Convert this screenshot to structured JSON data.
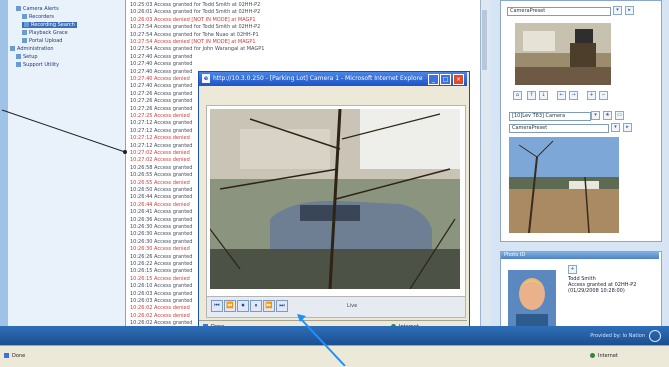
{
  "sidebar": {
    "items": [
      {
        "label": "Camera Alerts",
        "indent": 1
      },
      {
        "label": "Recorders",
        "indent": 2
      },
      {
        "label": "Recording Search",
        "indent": 2,
        "selected": true
      },
      {
        "label": "Playback Grace",
        "indent": 2
      },
      {
        "label": "Portal Upload",
        "indent": 2
      },
      {
        "label": "Administration",
        "indent": 0
      },
      {
        "label": "Setup",
        "indent": 1
      },
      {
        "label": "Support Utility",
        "indent": 1
      }
    ]
  },
  "log": {
    "lines": [
      {
        "time": "10:25:03",
        "text": "Access granted for Todd Smith at 02HH-P2",
        "status": "ok"
      },
      {
        "time": "10:26:01",
        "text": "Access granted for Todd Smith at 02HH-P2",
        "status": "ok"
      },
      {
        "time": "10:26:03",
        "text": "Access denied [NOT IN MODE] at MAGP1",
        "status": "bad"
      },
      {
        "time": "10:27:54",
        "text": "Access granted for Todd Smith at 02HH-P2",
        "status": "ok"
      },
      {
        "time": "10:27:54",
        "text": "Access granted for Tohe Nuao at 02HH-P1",
        "status": "ok"
      },
      {
        "time": "10:27:54",
        "text": "Access denied [NOT IN MODE] at MAGP1",
        "status": "bad"
      },
      {
        "time": "10:27:54",
        "text": "Access granted for John Warangal at MAGP1",
        "status": "ok"
      },
      {
        "time": "10:27:40",
        "text": "Access granted",
        "status": "ok"
      },
      {
        "time": "10:27:40",
        "text": "Access granted",
        "status": "ok"
      },
      {
        "time": "10:27:40",
        "text": "Access granted",
        "status": "ok"
      },
      {
        "time": "10:27:40",
        "text": "Access denied",
        "status": "bad"
      },
      {
        "time": "10:27:40",
        "text": "Access granted",
        "status": "ok"
      },
      {
        "time": "10:27:26",
        "text": "Access granted",
        "status": "ok"
      },
      {
        "time": "10:27:26",
        "text": "Access granted",
        "status": "ok"
      },
      {
        "time": "10:27:26",
        "text": "Access granted",
        "status": "ok"
      },
      {
        "time": "10:27:25",
        "text": "Access denied",
        "status": "bad"
      },
      {
        "time": "10:27:12",
        "text": "Access granted",
        "status": "ok"
      },
      {
        "time": "10:27:12",
        "text": "Access granted",
        "status": "ok"
      },
      {
        "time": "10:27:12",
        "text": "Access denied",
        "status": "bad"
      },
      {
        "time": "10:27:12",
        "text": "Access granted",
        "status": "ok"
      },
      {
        "time": "10:27:02",
        "text": "Access denied",
        "status": "bad"
      },
      {
        "time": "10:27:02",
        "text": "Access denied",
        "status": "bad"
      },
      {
        "time": "10:26:58",
        "text": "Access granted",
        "status": "ok"
      },
      {
        "time": "10:26:55",
        "text": "Access granted",
        "status": "ok"
      },
      {
        "time": "10:26:55",
        "text": "Access denied",
        "status": "bad"
      },
      {
        "time": "10:26:50",
        "text": "Access granted",
        "status": "ok"
      },
      {
        "time": "10:26:44",
        "text": "Access granted",
        "status": "ok"
      },
      {
        "time": "10:26:44",
        "text": "Access denied",
        "status": "bad"
      },
      {
        "time": "10:26:41",
        "text": "Access granted",
        "status": "ok"
      },
      {
        "time": "10:26:36",
        "text": "Access granted",
        "status": "ok"
      },
      {
        "time": "10:26:30",
        "text": "Access granted",
        "status": "ok"
      },
      {
        "time": "10:26:30",
        "text": "Access granted",
        "status": "ok"
      },
      {
        "time": "10:26:30",
        "text": "Access granted",
        "status": "ok"
      },
      {
        "time": "10:26:30",
        "text": "Access denied",
        "status": "bad"
      },
      {
        "time": "10:26:26",
        "text": "Access granted",
        "status": "ok"
      },
      {
        "time": "10:26:22",
        "text": "Access granted",
        "status": "ok"
      },
      {
        "time": "10:26:15",
        "text": "Access granted",
        "status": "ok"
      },
      {
        "time": "10:26:15",
        "text": "Access denied",
        "status": "bad"
      },
      {
        "time": "10:26:10",
        "text": "Access granted",
        "status": "ok"
      },
      {
        "time": "10:26:03",
        "text": "Access granted",
        "status": "ok"
      },
      {
        "time": "10:26:03",
        "text": "Access granted",
        "status": "ok"
      },
      {
        "time": "10:26:02",
        "text": "Access denied",
        "status": "bad"
      },
      {
        "time": "10:26:02",
        "text": "Access denied",
        "status": "bad"
      },
      {
        "time": "10:26:02",
        "text": "Access granted",
        "status": "ok"
      }
    ]
  },
  "popup": {
    "title": "http://10.3.0.250 - [Parking Lot] Camera 1 - Microsoft Internet Explorer",
    "live_label": "Live",
    "status_left": "Done",
    "status_right": "Internet",
    "controls": [
      "⏮",
      "⏪",
      "⏺",
      "⏸",
      "⏩",
      "⏭"
    ]
  },
  "right": {
    "cam1_select": "CameraPreset",
    "cam2_title": "[10]Lev T83] Camera",
    "cam2_select": "CameraPreset"
  },
  "photo_id": {
    "title": "Photo ID",
    "name": "Todd Smith",
    "message": "Access granted at 02HH-P2",
    "timestamp": "(01/29/2008 10:28:00)"
  },
  "footer": {
    "brand": "Provided by: lo Nation"
  },
  "statusbar": {
    "left": "Done",
    "right": "Internet"
  },
  "colors": {
    "granted": "#404a5a",
    "denied": "#d23a3a",
    "titlebar": "#1c53c7",
    "callout": "#1e90ff"
  }
}
